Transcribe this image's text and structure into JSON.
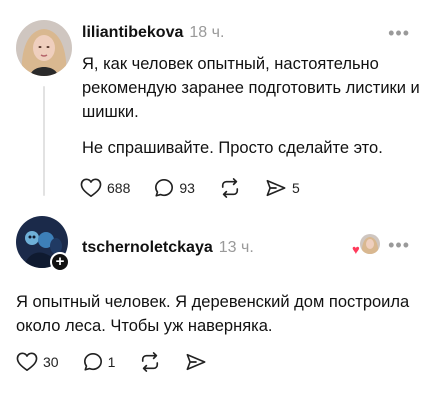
{
  "post1": {
    "username": "liliantibekova",
    "time": "18 ч.",
    "paragraph1": "Я, как человек опытный, настоятельно рекомендую заранее подготовить листики и шишки.",
    "paragraph2": "Не спрашивайте. Просто сделайте это.",
    "likes": "688",
    "comments": "93",
    "shares": "5",
    "more_icon": "more-horizontal-icon"
  },
  "post2": {
    "username": "tschernoletckaya",
    "time": "13 ч.",
    "text": "Я опытный человек. Я деревенский  дом построила около леса. Чтобы уж наверняка.",
    "likes": "30",
    "comments": "1",
    "plus": "+",
    "reaction_icon": "heart-icon"
  },
  "colors": {
    "text": "#111111",
    "secondary": "#9a9a9a",
    "heart": "#ff3b5c"
  }
}
